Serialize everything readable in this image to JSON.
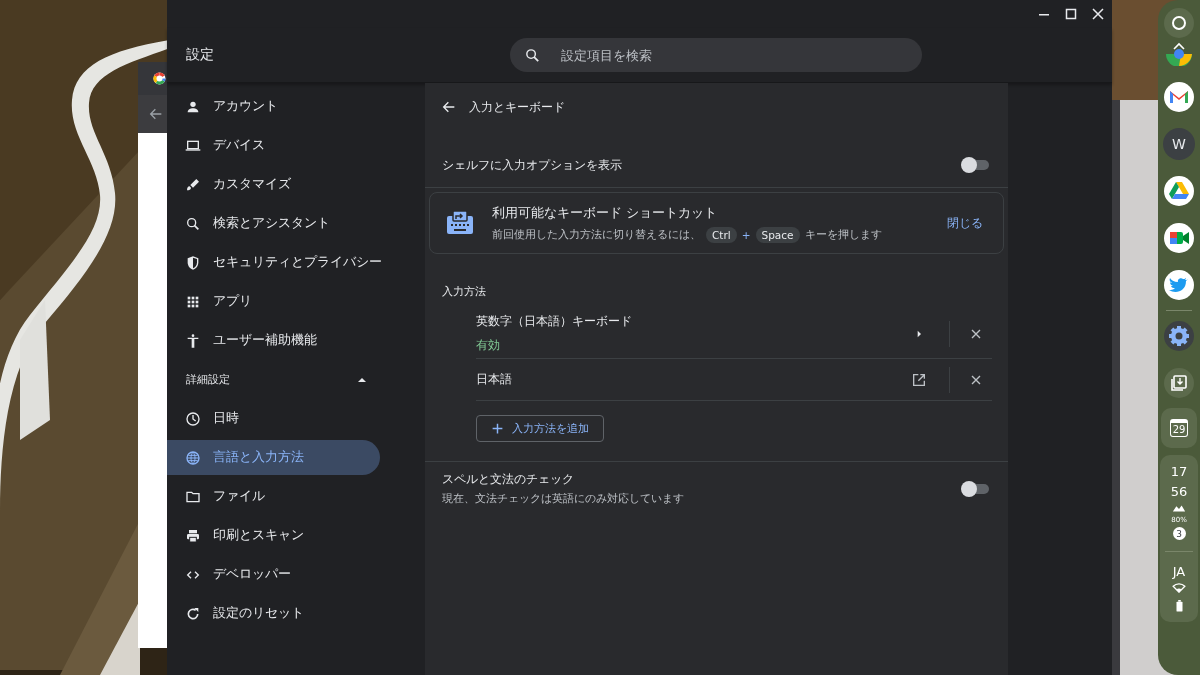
{
  "window": {
    "title": "設定",
    "search": {
      "placeholder": "設定項目を検索"
    }
  },
  "sidebar": {
    "items": [
      {
        "label": "アカウント",
        "selected": false
      },
      {
        "label": "デバイス",
        "selected": false
      },
      {
        "label": "カスタマイズ",
        "selected": false
      },
      {
        "label": "検索とアシスタント",
        "selected": false
      },
      {
        "label": "セキュリティとプライバシー",
        "selected": false
      },
      {
        "label": "アプリ",
        "selected": false
      },
      {
        "label": "ユーザー補助機能",
        "selected": false
      }
    ],
    "advanced": {
      "label": "詳細設定",
      "expanded": true,
      "items": [
        {
          "label": "日時",
          "selected": false
        },
        {
          "label": "言語と入力方法",
          "selected": true
        },
        {
          "label": "ファイル",
          "selected": false
        },
        {
          "label": "印刷とスキャン",
          "selected": false
        },
        {
          "label": "デベロッパー",
          "selected": false
        },
        {
          "label": "設定のリセット",
          "selected": false
        }
      ]
    }
  },
  "page": {
    "title": "入力とキーボード",
    "shelf_option": {
      "label": "シェルフに入力オプションを表示",
      "on": false
    },
    "shortcut_card": {
      "title": "利用可能なキーボード ショートカット",
      "text_before": "前回使用した入力方法に切り替えるには、",
      "keys": [
        "Ctrl",
        "Space"
      ],
      "plus": "+",
      "text_after": "キーを押します",
      "close": "閉じる"
    },
    "input_methods": {
      "heading": "入力方法",
      "items": [
        {
          "name": "英数字（日本語）キーボード",
          "status": "有効",
          "kind": "settings"
        },
        {
          "name": "日本語",
          "kind": "external"
        }
      ],
      "add_button": "入力方法を追加"
    },
    "spell_check": {
      "label": "スペルと文法のチェック",
      "description": "現在、文法チェックは英語にのみ対応しています",
      "on": false
    }
  },
  "shelf": {
    "avatar": "W",
    "calendar_day": "29",
    "clock": [
      "17",
      "56"
    ],
    "battery_saver": "80%",
    "notifications": "3",
    "ime": "JA"
  }
}
